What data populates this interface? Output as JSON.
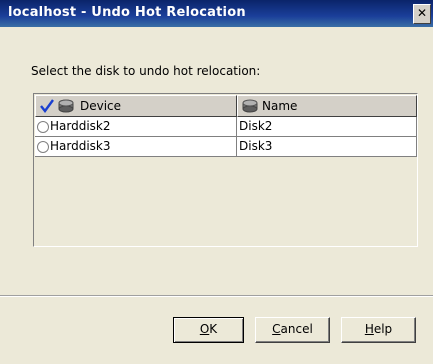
{
  "window": {
    "title": "localhost - Undo Hot Relocation",
    "close_glyph": "✕"
  },
  "instruction": "Select the disk to undo hot relocation:",
  "table": {
    "columns": [
      {
        "label": "Device",
        "icon": "disk-icon"
      },
      {
        "label": "Name",
        "icon": "disk-icon"
      }
    ],
    "header_checked": true,
    "rows": [
      {
        "device": "Harddisk2",
        "name": "Disk2",
        "selected": false
      },
      {
        "device": "Harddisk3",
        "name": "Disk3",
        "selected": false
      }
    ]
  },
  "buttons": {
    "ok": {
      "mnemonic": "O",
      "rest": "K"
    },
    "cancel": {
      "mnemonic": "C",
      "rest": "ancel"
    },
    "help": {
      "mnemonic": "H",
      "rest": "elp"
    }
  },
  "colors": {
    "titlebar": "#0a246a",
    "dialog_bg": "#ece9d8",
    "check": "#1a3fd0"
  }
}
